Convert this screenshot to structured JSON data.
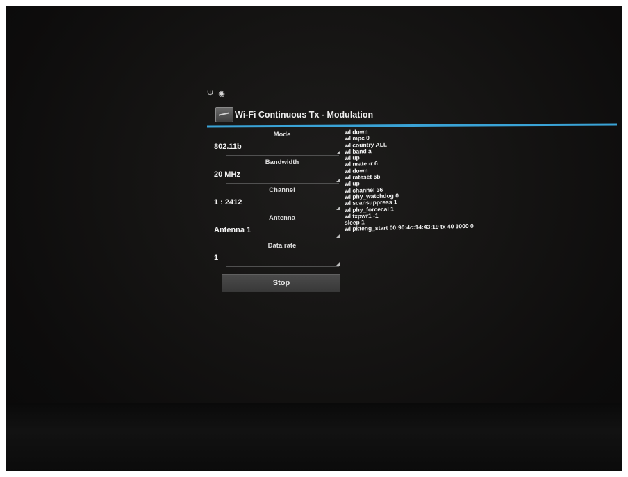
{
  "window": {
    "title": "Wi-Fi Continuous Tx - Modulation",
    "accent_color": "#3aa3d6"
  },
  "status_bar": {
    "icons": [
      "usb-icon",
      "debug-icon"
    ]
  },
  "settings": [
    {
      "label": "Mode",
      "value": "802.11b"
    },
    {
      "label": "Bandwidth",
      "value": "20 MHz"
    },
    {
      "label": "Channel",
      "value": "1 : 2412"
    },
    {
      "label": "Antenna",
      "value": "Antenna 1"
    },
    {
      "label": "Data rate",
      "value": "1"
    }
  ],
  "actions": {
    "stop_label": "Stop"
  },
  "command_log": [
    "wl down",
    "wl mpc 0",
    "wl country ALL",
    "wl band a",
    "wl up",
    "wl nrate -r 6",
    "wl down",
    "wl rateset 6b",
    "wl up",
    "wl channel 36",
    "wl phy_watchdog 0",
    "wl scansuppress 1",
    "wl phy_forcecal 1",
    "wl txpwr1 -1",
    "sleep 1",
    "wl pkteng_start 00:90:4c:14:43:19 tx 40 1000 0"
  ]
}
